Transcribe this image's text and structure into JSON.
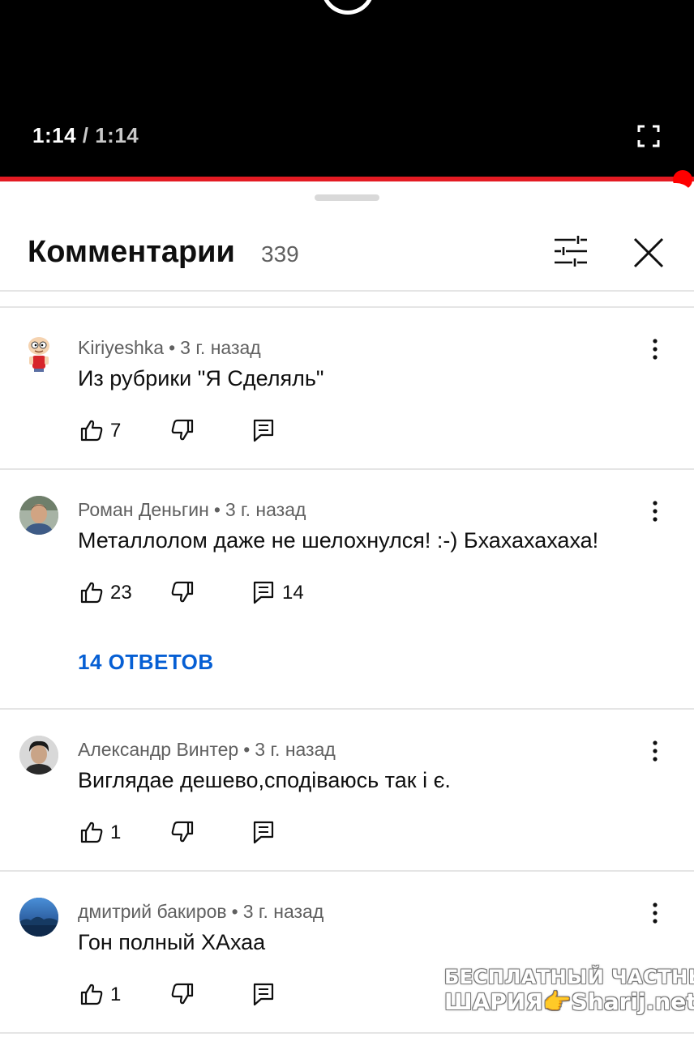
{
  "player": {
    "current_time": "1:14",
    "separator": " / ",
    "duration": "1:14",
    "progress": 1.0,
    "accent_color": "#ff0000"
  },
  "comments_header": {
    "title": "Комментарии",
    "count": "339",
    "filter_icon": "sliders-icon",
    "close_icon": "close-icon"
  },
  "comments": [
    {
      "author": "Kiriyeshka",
      "age": "3 г. назад",
      "text": "Из рубрики \"Я Сделяль\"",
      "likes": "7",
      "replies_count": "",
      "avatar": "cartoon-avatar"
    },
    {
      "author": "Роман Деньгин",
      "age": "3 г. назад",
      "text": "Металлолом даже не шелохнулся! :-) Бхахахахаха!",
      "likes": "23",
      "replies_count": "14",
      "replies_link": "14 ОТВЕТОВ",
      "avatar": "photo-avatar"
    },
    {
      "author": "Александр Винтер",
      "age": "3 г. назад",
      "text": "Виглядае дешево,сподіваюсь так і є.",
      "likes": "1",
      "replies_count": "",
      "avatar": "photo-avatar"
    },
    {
      "author": "дмитрий бакиров",
      "age": "3 г. назад",
      "text": "Гон полный ХАхаа",
      "likes": "1",
      "replies_count": "",
      "avatar": "landscape-avatar"
    }
  ],
  "watermark": {
    "line1": "БЕСПЛАТНЫЙ ЧАСТНЫЙ",
    "line2": "ШАРИЯ👉Sharij.net"
  }
}
